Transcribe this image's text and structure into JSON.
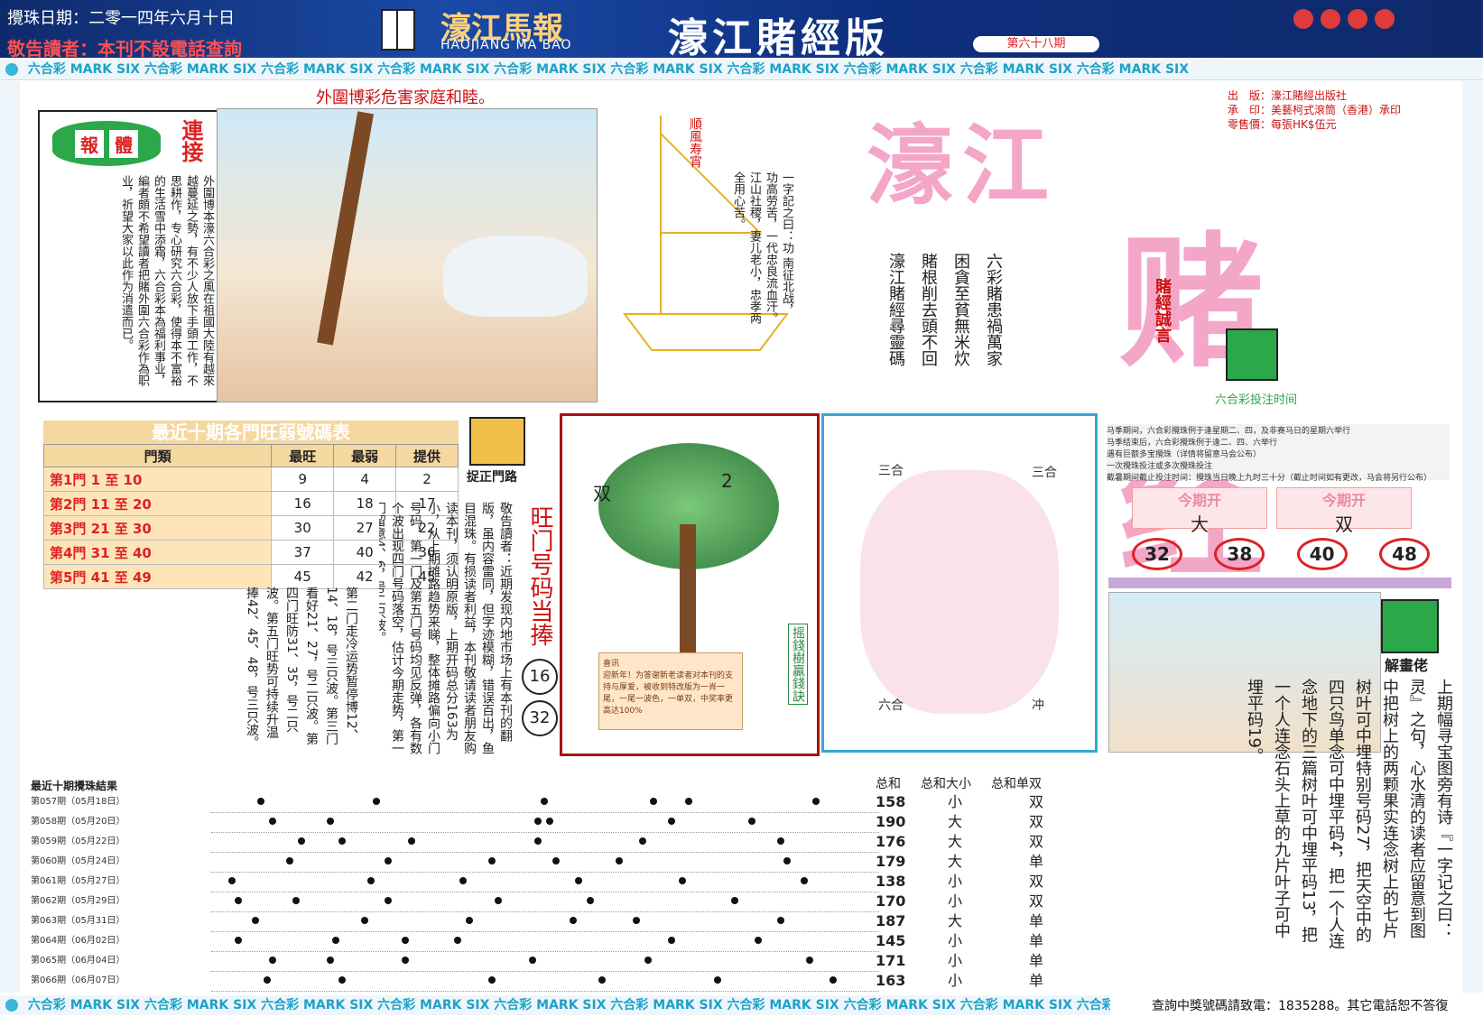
{
  "header": {
    "draw_date": "攪珠日期：二零一四年六月十日",
    "notice": "敬告讀者：本刊不設電話查詢",
    "logo_cn": "濠江馬報",
    "logo_en": "HAOJIANG MA BAO",
    "edition": "濠江賭經版",
    "issue": "第六十八期"
  },
  "ribbon": {
    "text": "六合彩 MARK SIX 六合彩 MARK SIX 六合彩 MARK SIX 六合彩 MARK SIX 六合彩 MARK SIX 六合彩 MARK SIX 六合彩 MARK SIX 六合彩 MARK SIX 六合彩 MARK SIX 六合彩 MARK SIX"
  },
  "warning": "外圍博彩危害家庭和睦。",
  "intro": {
    "badge": [
      "報",
      "體"
    ],
    "title": "連接",
    "text": "外圍博本濠六合彩之風在祖國大陸有越來越蔓延之勢，有不少人放下手頭工作，不思耕作，专心研究六合彩，使得本不富裕的生活雪中添霜，六合彩本為福利事业，編者頗不希望讀者把賭外圍六合彩作為职业，祈望大家以此作为消遣而已。"
  },
  "boat": {
    "tag": "順風寿宵",
    "text": "一字記之曰：功 南征北战，功高劳苦，一代忠良流血汗。江山社稷，妻儿老小，忠孝两全用心苦。"
  },
  "title_big": {
    "part1": "濠江",
    "part2": "赌经"
  },
  "publish": {
    "lines": [
      "出　版：濠江賭經出版社",
      "承　印：美藝柯式滾筒（香港）承印",
      "零售價：每張HK$伍元"
    ]
  },
  "verse": {
    "lines": [
      "六彩賭患禍萬家",
      "困貪至貧無米炊",
      "賭根削去頭不回",
      "濠江賭經尋靈碼"
    ]
  },
  "motto": "賭經誠言",
  "hot_table": {
    "title": "最近十期各門旺弱號碼表",
    "headers": [
      "門類",
      "最旺",
      "最弱",
      "提供"
    ],
    "rows": [
      {
        "door": "第1門",
        "range": "1 至 10",
        "hot": "9",
        "weak": "4",
        "offer": "2"
      },
      {
        "door": "第2門",
        "range": "11 至 20",
        "hot": "16",
        "weak": "18",
        "offer": "17"
      },
      {
        "door": "第3門",
        "range": "21 至 30",
        "hot": "30",
        "weak": "27",
        "offer": "22"
      },
      {
        "door": "第4門",
        "range": "31 至 40",
        "hot": "37",
        "weak": "40",
        "offer": "36"
      },
      {
        "door": "第5門",
        "range": "41 至 49",
        "hot": "45",
        "weak": "42",
        "offer": "45"
      }
    ]
  },
  "grab_label": "捉正門路",
  "readers": "敬告讀者：近期发现内地市场上有本刊的翻版，虽内容雷同，但字迹模糊，错误百出，鱼目混珠。有损读者利益，本刊敬请读者朋友购读本刊，须认明原版，上期开码总分163为小，从上期摊路趋势来睇，整体摊路偏向小门号码，第一门及第五门号码均见反弹，各有数个波出现四门号码落空，估计今期走势，第一门留意4、6，号二只波。",
  "analysis": "第二门走冷运势暂停博12、14、18，号三只波。第三门看好21、27，号二只波。第四门旺防31、35，号二只波。第五门旺势可持续升温捧42、45、48，号三只波。",
  "hotnum": {
    "label": "旺门号码当捧",
    "balls": [
      "16",
      "32"
    ]
  },
  "money_tree": {
    "label": "摇錢樹贏錢訣",
    "tag1": "双",
    "tag2": "2",
    "news_title": "喜讯",
    "news_text": "迎新年！为答谢新老读者对本刊的支持与厚爱，被收到特改版为一肖一尾，一尾一波色，一单双，中奖率更高达100%"
  },
  "zodiac": {
    "labels": [
      "三合",
      "三合",
      "六合",
      "冲"
    ]
  },
  "time": {
    "title": "六合彩投注时间",
    "lines": [
      "马季期间，六合彩攪珠例于逢星期二、四，及非赛马日的星期六举行",
      "马季结束后，六合彩攪珠例于逢二、四、六举行",
      "遇有巨额多宝攪珠（详情将留意马会公布）",
      "一次攪珠投注或多次攪珠投注",
      "截暑期间截止投注时间：攪珠当日晚上九时三十分（截止时间如有更改，马会将另行公布）"
    ]
  },
  "open": {
    "cells": [
      {
        "title": "今期开",
        "value": "大"
      },
      {
        "title": "今期开",
        "value": "双"
      }
    ],
    "balls": [
      "32",
      "38",
      "40",
      "48"
    ]
  },
  "solve": {
    "label": "解畫佬",
    "text": "上期幅寻宝图旁有诗『一字记之曰：灵』之句，心水清的读者应留意到图中把树上的两颗果实连念树上的七片树叶可中埋特别号码27，把天空中的四只鸟单念可中埋平码4，把一个人连念地下的三篇树叶可中埋平码13，把一个人连念石头上草的九片叶子可中埋平码19。"
  },
  "results": {
    "title": "最近十期攪珠結果",
    "rows": [
      {
        "label": "第057期（05月18日）",
        "dots": [
          16,
          56,
          114,
          152,
          164,
          208
        ]
      },
      {
        "label": "第058期（05月20日）",
        "dots": [
          20,
          40,
          112,
          116,
          158,
          186
        ]
      },
      {
        "label": "第059期（05月22日）",
        "dots": [
          30,
          44,
          68,
          112,
          148,
          196
        ]
      },
      {
        "label": "第060期（05月24日）",
        "dots": [
          26,
          60,
          96,
          118,
          140,
          198
        ]
      },
      {
        "label": "第061期（05月27日）",
        "dots": [
          6,
          54,
          86,
          126,
          162,
          204
        ]
      },
      {
        "label": "第062期（05月29日）",
        "dots": [
          8,
          28,
          60,
          98,
          130,
          180
        ]
      },
      {
        "label": "第063期（05月31日）",
        "dots": [
          14,
          52,
          88,
          124,
          146,
          196
        ]
      },
      {
        "label": "第064期（06月02日）",
        "dots": [
          8,
          42,
          66,
          84,
          158,
          188
        ]
      },
      {
        "label": "第065期（06月04日）",
        "dots": [
          20,
          40,
          66,
          110,
          150,
          206
        ]
      },
      {
        "label": "第066期（06月07日）",
        "dots": [
          18,
          44,
          96,
          134,
          174,
          214
        ]
      }
    ]
  },
  "summary": {
    "headers": [
      "总和",
      "总和大小",
      "总和单双"
    ],
    "rows": [
      {
        "sum": "158",
        "size": "小",
        "oddeven": "双"
      },
      {
        "sum": "190",
        "size": "大",
        "oddeven": "双"
      },
      {
        "sum": "176",
        "size": "大",
        "oddeven": "双"
      },
      {
        "sum": "179",
        "size": "大",
        "oddeven": "单"
      },
      {
        "sum": "138",
        "size": "小",
        "oddeven": "双"
      },
      {
        "sum": "170",
        "size": "小",
        "oddeven": "双"
      },
      {
        "sum": "187",
        "size": "大",
        "oddeven": "单"
      },
      {
        "sum": "145",
        "size": "小",
        "oddeven": "单"
      },
      {
        "sum": "171",
        "size": "小",
        "oddeven": "单"
      },
      {
        "sum": "163",
        "size": "小",
        "oddeven": "单"
      }
    ]
  },
  "hotline": "查詢中獎號碼請致電：1835288。其它電話恕不答復"
}
